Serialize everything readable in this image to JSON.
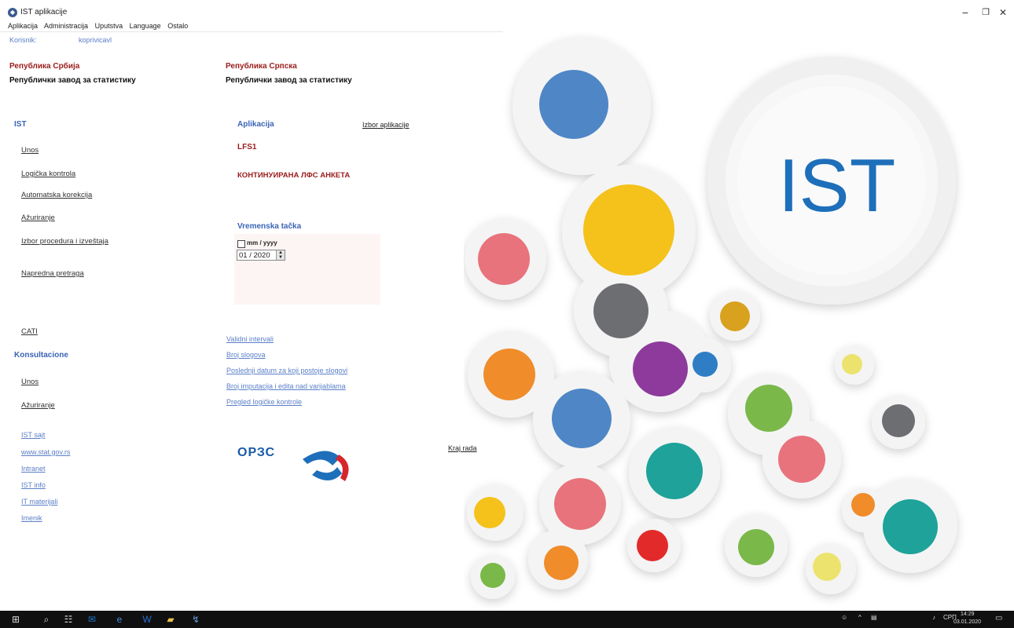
{
  "window": {
    "title": "IST aplikacije",
    "minimize": "−",
    "restore": "❐",
    "close": "✕"
  },
  "menu": [
    "Aplikacija",
    "Administracija",
    "Uputstva",
    "Language",
    "Ostalo"
  ],
  "user": {
    "label": "Korisnik:",
    "name": "koprivicavl"
  },
  "left_header": {
    "republic": "Република Србија",
    "institute": "Републички завод за статистику"
  },
  "right_header": {
    "republic": "Република Српска",
    "institute": "Републички завод за статистику"
  },
  "ist": {
    "heading": "IST",
    "links": [
      "Unos",
      "Logička kontrola",
      "Automatska korekcija",
      "Ažuriranje",
      "Izbor procedura i izveštaja",
      "Napredna pretraga"
    ],
    "cati": "CATI"
  },
  "konsultacione": {
    "heading": "Konsultacione",
    "links": [
      "Unos",
      "Ažuriranje"
    ]
  },
  "external_links": [
    "IST sajt",
    "www.stat.gov.rs",
    "Intranet",
    "IST info",
    "IT materijali",
    "Imenik"
  ],
  "aplikacija": {
    "heading": "Aplikacija",
    "choose_link": "Izbor aplikacije",
    "code": "LFS1",
    "name": "КОНТИНУИРАНА ЛФС АНКЕТА"
  },
  "vremenska": {
    "heading": "Vremenska tačka",
    "format_label": "mm / yyyy",
    "value": "01 / 2020"
  },
  "info_links": [
    "Validni intervali",
    "Broj slogova",
    "Poslednji datum za koji postoje slogovi",
    "Broj imputacija i edita nad varijablama",
    "Pregled logičke kontrole"
  ],
  "logo_text": "ОРЗС",
  "exit_link": "Kraj rada",
  "hero_text": "IST",
  "colors": {
    "brand_blue": "#1e6fba",
    "heading_red": "#9b1c1c",
    "link_blue": "#5b7fc7"
  },
  "taskbar": {
    "time": "14:29",
    "date": "03.01.2020",
    "lang": "СРП"
  }
}
